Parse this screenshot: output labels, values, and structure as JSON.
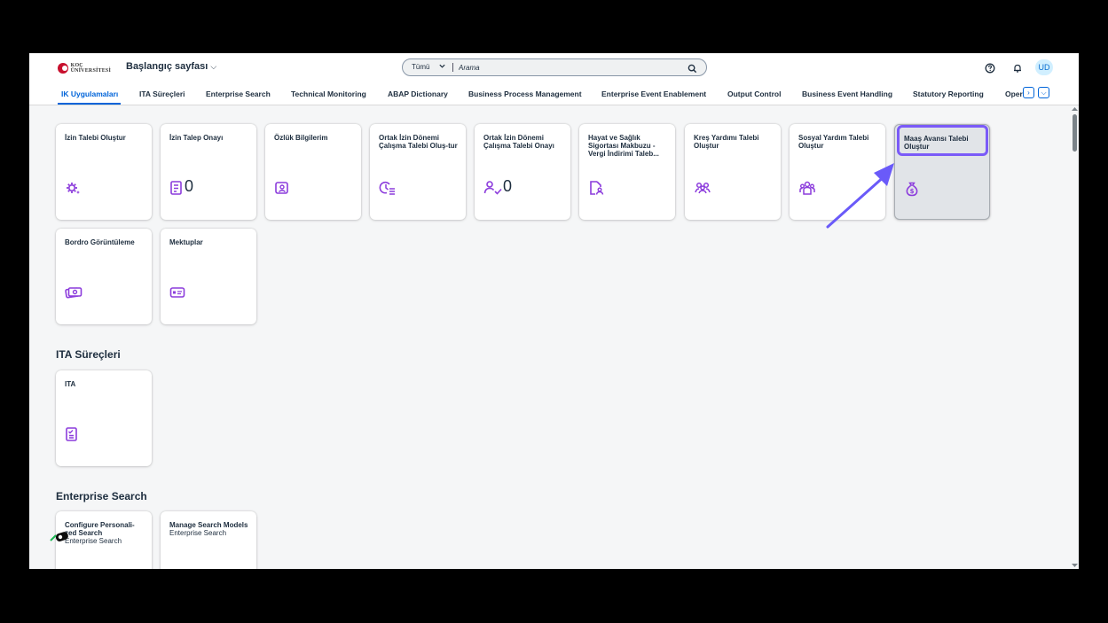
{
  "header": {
    "logo_text_top": "KOÇ",
    "logo_text_bottom": "ÜNİVERSİTESİ",
    "home_title": "Başlangıç sayfası",
    "search_scope": "Tümü",
    "search_placeholder": "Arama",
    "avatar_initials": "UD"
  },
  "tabs": [
    {
      "label": "IK Uygulamaları",
      "active": true
    },
    {
      "label": "ITA Süreçleri"
    },
    {
      "label": "Enterprise Search"
    },
    {
      "label": "Technical Monitoring"
    },
    {
      "label": "ABAP Dictionary"
    },
    {
      "label": "Business Process Management"
    },
    {
      "label": "Enterprise Event Enablement"
    },
    {
      "label": "Output Control"
    },
    {
      "label": "Business Event Handling"
    },
    {
      "label": "Statutory Reporting"
    },
    {
      "label": "Oper"
    }
  ],
  "ik_tiles": [
    {
      "title": "İzin Talebi Oluştur",
      "icon": "gear-sparkle-icon"
    },
    {
      "title": "İzin Talep Onayı",
      "icon": "checklist-icon",
      "count": "0"
    },
    {
      "title": "Özlük Bilgilerim",
      "icon": "person-card-icon"
    },
    {
      "title": "Ortak İzin Dönemi Çalışma Talebi Oluş-tur",
      "icon": "clock-list-icon"
    },
    {
      "title": "Ortak İzin Dönemi Çalışma Talebi Onayı",
      "icon": "person-check-icon",
      "count": "0"
    },
    {
      "title": "Hayat ve Sağlık Sigortası Makbuzu - Vergi İndirimi Taleb...",
      "icon": "document-person-icon"
    },
    {
      "title": "Kreş Yardımı Talebi Oluştur",
      "icon": "group-icon"
    },
    {
      "title": "Sosyal Yardım Talebi Oluştur",
      "icon": "team-support-icon"
    },
    {
      "title": "Maaş Avansı Talebi Oluştur",
      "icon": "money-bag-icon"
    },
    {
      "title": "Bordro Görüntüleme",
      "icon": "money-icon"
    },
    {
      "title": "Mektuplar",
      "icon": "card-icon"
    }
  ],
  "sections": {
    "ita": "ITA Süreçleri",
    "enterprise_search": "Enterprise Search"
  },
  "ita_tiles": [
    {
      "title": "ITA",
      "icon": "checklist-icon"
    }
  ],
  "es_tiles": [
    {
      "title": "Configure Personali-zed Search",
      "subtitle": "Enterprise Search"
    },
    {
      "title": "Manage Search Models",
      "subtitle": "Enterprise Search"
    }
  ],
  "colors": {
    "accent": "#0064d9",
    "icon": "#8c3cdc",
    "highlight": "#7a5af8"
  }
}
